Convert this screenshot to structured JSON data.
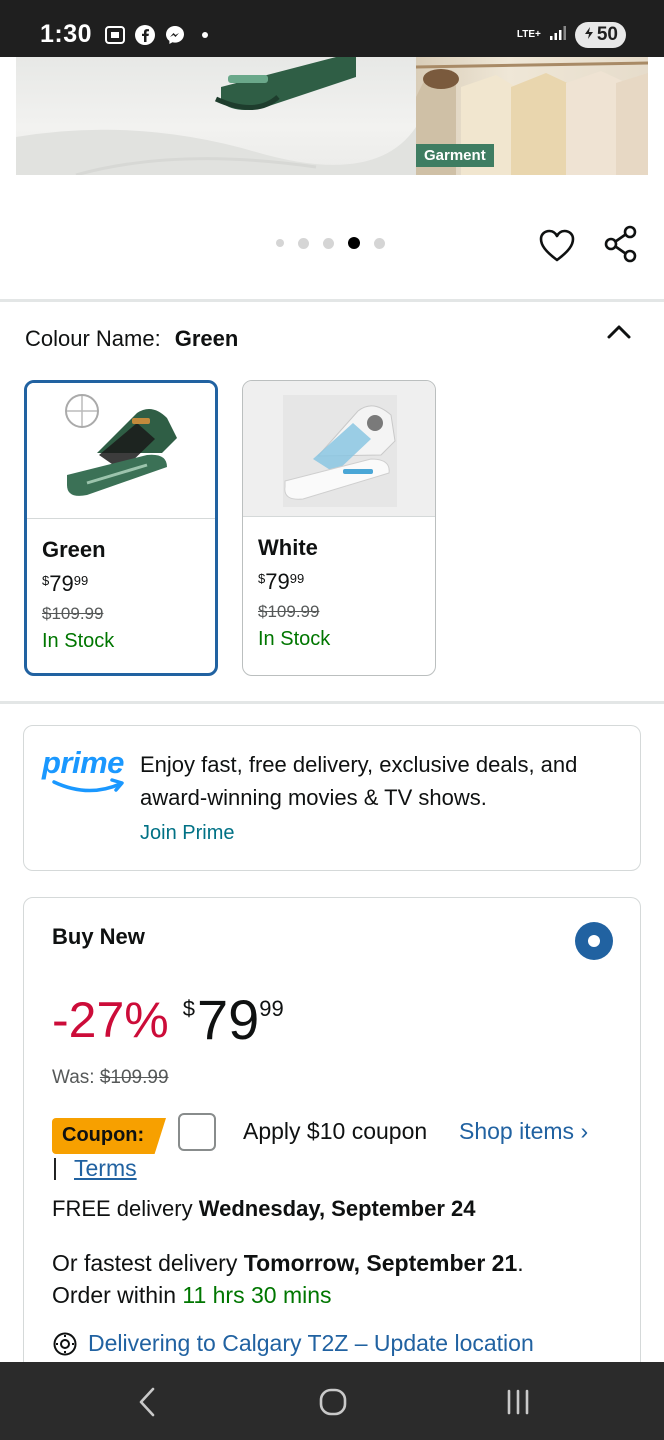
{
  "status_bar": {
    "time": "1:30",
    "network": "LTE+",
    "battery": "50"
  },
  "hero": {
    "tag": "Garment",
    "dots": 5,
    "active_dot": 4
  },
  "colour": {
    "label": "Colour Name:",
    "value": "Green"
  },
  "variants": [
    {
      "name": "Green",
      "price_currency": "$",
      "price_whole": "79",
      "price_cents": "99",
      "was": "$109.99",
      "stock": "In Stock",
      "selected": true
    },
    {
      "name": "White",
      "price_currency": "$",
      "price_whole": "79",
      "price_cents": "99",
      "was": "$109.99",
      "stock": "In Stock",
      "selected": false
    }
  ],
  "prime": {
    "logo": "prime",
    "text": "Enjoy fast, free delivery, exclusive deals, and award-winning movies & TV shows.",
    "link": "Join Prime"
  },
  "buy_box": {
    "title": "Buy New",
    "discount": "-27%",
    "currency": "$",
    "price_whole": "79",
    "price_cents": "99",
    "was_label": "Was:",
    "was_price": "$109.99",
    "coupon_badge": "Coupon:",
    "coupon_text": "Apply $10 coupon",
    "shop_items": "Shop items ›",
    "pipe": "|",
    "terms": "Terms",
    "delivery_prefix": "FREE delivery ",
    "delivery_date": "Wednesday, September 24",
    "fast_prefix": "Or fastest delivery ",
    "fast_date": "Tomorrow, September 21",
    "fast_period": ".",
    "order_within": "Order within ",
    "countdown": "11 hrs 30 mins",
    "location": "Delivering to Calgary T2Z – Update location"
  },
  "colors": {
    "link": "#2162a1",
    "deal_red": "#cc0c39",
    "in_stock": "#007600",
    "coupon": "#f7a000"
  }
}
